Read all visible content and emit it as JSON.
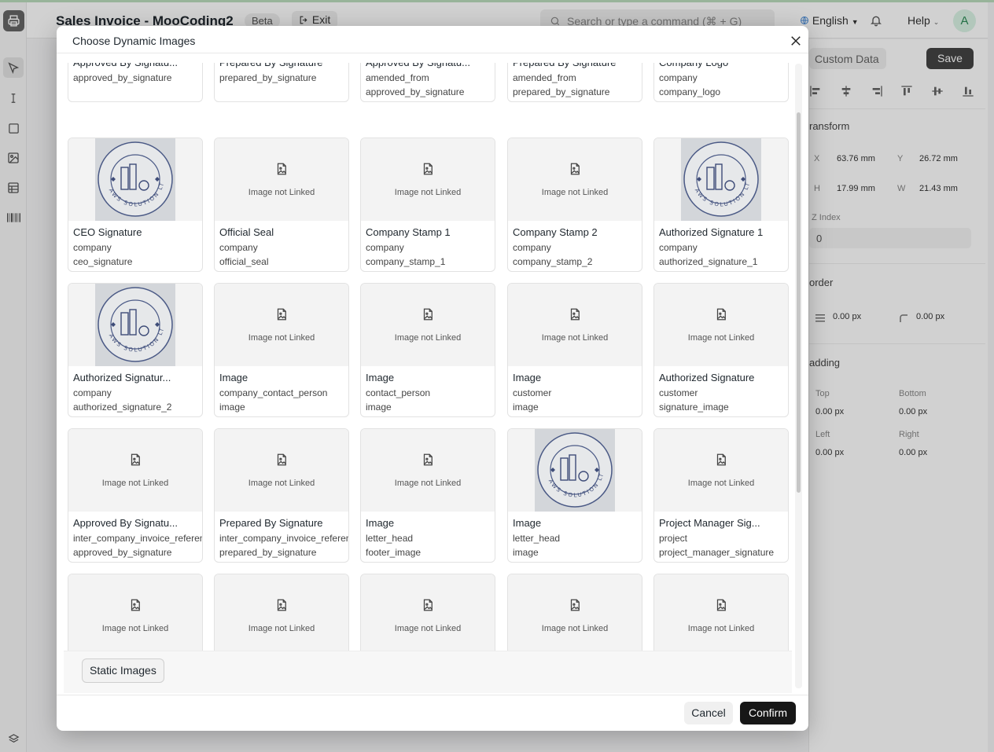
{
  "app": {
    "title": "Sales Invoice - MooCoding2",
    "beta": "Beta",
    "exit": "Exit",
    "search_placeholder": "Search or type a command (⌘ + G)",
    "language": "English",
    "help": "Help",
    "avatar": "A"
  },
  "properties": {
    "custom_data": "Custom Data",
    "save": "Save",
    "transform_title": "ransform",
    "x_label": "X",
    "x_value": "63.76 mm",
    "y_label": "Y",
    "y_value": "26.72 mm",
    "h_label": "H",
    "h_value": "17.99 mm",
    "w_label": "W",
    "w_value": "21.43 mm",
    "zindex_label": "Z Index",
    "zindex_value": "0",
    "border_title": "order",
    "border_width": "0.00 px",
    "border_radius": "0.00 px",
    "padding_title": "adding",
    "top_label": "Top",
    "top_value": "0.00 px",
    "bottom_label": "Bottom",
    "bottom_value": "0.00 px",
    "left_label": "Left",
    "left_value": "0.00 px",
    "right_label": "Right",
    "right_value": "0.00 px"
  },
  "modal": {
    "title": "Choose Dynamic Images",
    "not_linked": "Image not Linked",
    "static_images": "Static Images",
    "cancel": "Cancel",
    "confirm": "Confirm",
    "top_row": [
      {
        "title": "Approved By Signatu...",
        "l1": "approved_by_signature",
        "l2": ""
      },
      {
        "title": "Prepared By Signature",
        "l1": "prepared_by_signature",
        "l2": ""
      },
      {
        "title": "Approved By Signatu...",
        "l1": "amended_from",
        "l2": "approved_by_signature"
      },
      {
        "title": "Prepared By Signature",
        "l1": "amended_from",
        "l2": "prepared_by_signature"
      },
      {
        "title": "Company Logo",
        "l1": "company",
        "l2": "company_logo"
      }
    ],
    "rows": [
      [
        {
          "title": "CEO Signature",
          "l1": "company",
          "l2": "ceo_signature",
          "has_image": true
        },
        {
          "title": "Official Seal",
          "l1": "company",
          "l2": "official_seal",
          "has_image": false
        },
        {
          "title": "Company Stamp 1",
          "l1": "company",
          "l2": "company_stamp_1",
          "has_image": false
        },
        {
          "title": "Company Stamp 2",
          "l1": "company",
          "l2": "company_stamp_2",
          "has_image": false
        },
        {
          "title": "Authorized Signature 1",
          "l1": "company",
          "l2": "authorized_signature_1",
          "has_image": true
        }
      ],
      [
        {
          "title": "Authorized Signatur...",
          "l1": "company",
          "l2": "authorized_signature_2",
          "has_image": true
        },
        {
          "title": "Image",
          "l1": "company_contact_person",
          "l2": "image",
          "has_image": false
        },
        {
          "title": "Image",
          "l1": "contact_person",
          "l2": "image",
          "has_image": false
        },
        {
          "title": "Image",
          "l1": "customer",
          "l2": "image",
          "has_image": false
        },
        {
          "title": "Authorized Signature",
          "l1": "customer",
          "l2": "signature_image",
          "has_image": false
        }
      ],
      [
        {
          "title": "Approved By Signatu...",
          "l1": "inter_company_invoice_reference",
          "l2": "approved_by_signature",
          "has_image": false
        },
        {
          "title": "Prepared By Signature",
          "l1": "inter_company_invoice_reference",
          "l2": "prepared_by_signature",
          "has_image": false
        },
        {
          "title": "Image",
          "l1": "letter_head",
          "l2": "footer_image",
          "has_image": false
        },
        {
          "title": "Image",
          "l1": "letter_head",
          "l2": "image",
          "has_image": true
        },
        {
          "title": "Project Manager Sig...",
          "l1": "project",
          "l2": "project_manager_signature",
          "has_image": false
        }
      ],
      [
        {
          "title": "",
          "l1": "",
          "l2": "",
          "has_image": false
        },
        {
          "title": "",
          "l1": "",
          "l2": "",
          "has_image": false
        },
        {
          "title": "",
          "l1": "",
          "l2": "",
          "has_image": false
        },
        {
          "title": "",
          "l1": "",
          "l2": "",
          "has_image": false
        },
        {
          "title": "",
          "l1": "",
          "l2": "",
          "has_image": false
        }
      ]
    ],
    "seal_text": "AWS SOLUTION LTD."
  }
}
